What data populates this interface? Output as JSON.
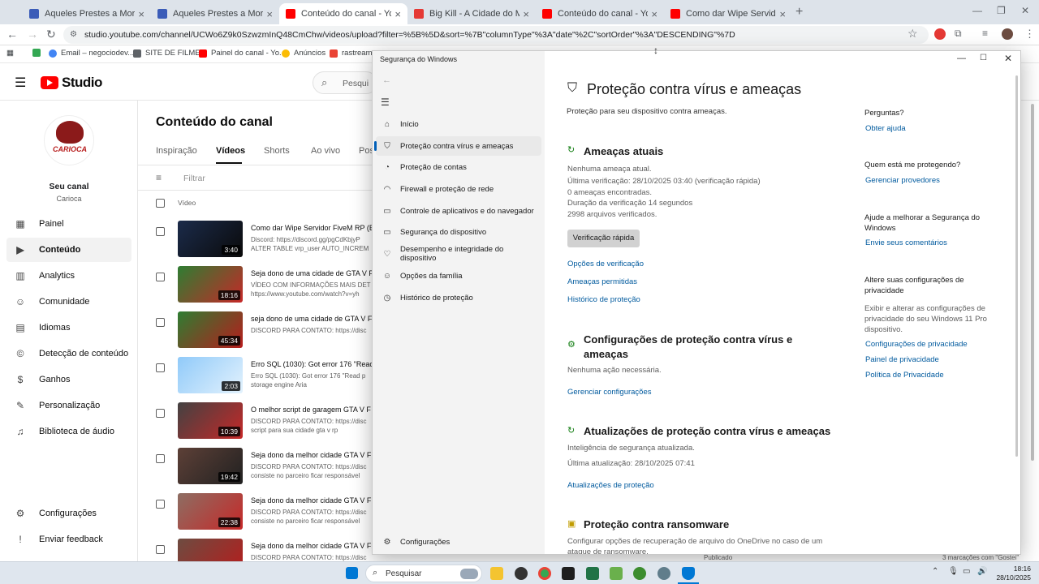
{
  "tabs": [
    {
      "label": "Aqueles Prestes a Morrer (Dub",
      "color": "#3b5cb8"
    },
    {
      "label": "Aqueles Prestes a Morrer - Epi",
      "color": "#3b5cb8"
    },
    {
      "label": "Conteúdo do canal - YouTube S",
      "color": "#ff0000"
    },
    {
      "label": "Big Kill - A Cidade do Medo | Fi",
      "color": "#e53935"
    },
    {
      "label": "Conteúdo do canal - YouTube S",
      "color": "#ff0000"
    },
    {
      "label": "Como dar Wipe Servidor FiveM",
      "color": "#ff0000"
    }
  ],
  "url": "studio.youtube.com/channel/UCWo6Z9k0SzwzmInQ48CmChw/videos/upload?filter=%5B%5D&sort=%7B\"columnType\"%3A\"date\"%2C\"sortOrder\"%3A\"DESCENDING\"%7D",
  "bookmarks": [
    "Email – negociodev...",
    "SITE DE FILMES",
    "Painel do canal - Yo...",
    "Anúncios",
    "rastreamen"
  ],
  "yt": {
    "logo": "Studio",
    "search_placeholder": "Pesqui",
    "page_title": "Conteúdo do canal",
    "tabs": [
      "Inspiração",
      "Vídeos",
      "Shorts",
      "Ao vivo",
      "Pos"
    ],
    "filter_placeholder": "Filtrar",
    "col_video": "Vídeo",
    "channel_avatar_text": "CARIOCA",
    "channel_label": "Seu canal",
    "channel_name": "Carioca",
    "side": [
      "Painel",
      "Conteúdo",
      "Analytics",
      "Comunidade",
      "Idiomas",
      "Detecção de conteúdo",
      "Ganhos",
      "Personalização",
      "Biblioteca de áudio"
    ],
    "side_bottom": [
      "Configurações",
      "Enviar feedback"
    ],
    "videos": [
      {
        "title": "Como dar Wipe Servidor FiveM RP (E",
        "desc1": "Discord: https://discord.gg/pgCdKbjyP",
        "desc2": "ALTER TABLE vrp_user AUTO_INCREM",
        "dur": "3:40",
        "c1": "#1b2b4a",
        "c2": "#0a0a0a"
      },
      {
        "title": "Seja dono de uma cidade de GTA V F",
        "desc1": "VÍDEO COM INFORMAÇÕES MAIS DET",
        "desc2": "https://www.youtube.com/watch?v=yh",
        "dur": "18:16",
        "c1": "#2e7d32",
        "c2": "#c62828"
      },
      {
        "title": "seja dono de uma cidade de GTA V Five",
        "desc1": "DISCORD PARA CONTATO: https://disc",
        "desc2": "",
        "dur": "45:34",
        "c1": "#2e7d32",
        "c2": "#b71c1c"
      },
      {
        "title": "Erro SQL (1030): Got error 176 \"Reac",
        "desc1": "Erro SQL (1030): Got error 176 \"Read p",
        "desc2": "storage engine Aria",
        "dur": "2:03",
        "c1": "#90caf9",
        "c2": "#e3f2fd"
      },
      {
        "title": "O melhor script de garagem GTA V F",
        "desc1": "DISCORD PARA CONTATO: https://disc",
        "desc2": "script para sua cidade gta v rp",
        "dur": "10:39",
        "c1": "#424242",
        "c2": "#c62828"
      },
      {
        "title": "Seja dono da melhor cidade GTA V F",
        "desc1": "DISCORD PARA CONTATO: https://disc",
        "desc2": "consiste no parceiro ficar responsável",
        "dur": "19:42",
        "c1": "#5d4037",
        "c2": "#212121"
      },
      {
        "title": "Seja dono da melhor cidade GTA V F",
        "desc1": "DISCORD PARA CONTATO: https://disc",
        "desc2": "consiste no parceiro ficar responsável",
        "dur": "22:38",
        "c1": "#8d6e63",
        "c2": "#c62828"
      },
      {
        "title": "Seja dono da melhor cidade GTA V Five",
        "desc1": "DISCORD PARA CONTATO: https://disc",
        "desc2": "",
        "dur": "",
        "c1": "#6d4c41",
        "c2": "#b71c1c"
      }
    ]
  },
  "security": {
    "window_title": "Segurança do Windows",
    "nav": [
      "Início",
      "Proteção contra vírus e ameaças",
      "Proteção de contas",
      "Firewall e proteção de rede",
      "Controle de aplicativos e do navegador",
      "Segurança do dispositivo",
      "Desempenho e integridade do dispositivo",
      "Opções da família",
      "Histórico de proteção"
    ],
    "nav_settings": "Configurações",
    "title": "Proteção contra vírus e ameaças",
    "subtitle": "Proteção para seu dispositivo contra ameaças.",
    "current_threats": {
      "heading": "Ameaças atuais",
      "lines": [
        "Nenhuma ameaça atual.",
        "Última verificação: 28/10/2025 03:40 (verificação rápida)",
        "0 ameaças encontradas.",
        "Duração da verificação 14 segundos",
        "2998 arquivos verificados."
      ],
      "button": "Verificação rápida",
      "links": [
        "Opções de verificação",
        "Ameaças permitidas",
        "Histórico de proteção"
      ]
    },
    "settings_section": {
      "heading": "Configurações de proteção contra vírus e ameaças",
      "line": "Nenhuma ação necessária.",
      "link": "Gerenciar configurações"
    },
    "updates": {
      "heading": "Atualizações de proteção contra vírus e ameaças",
      "lines": [
        "Inteligência de segurança atualizada.",
        "Última atualização: 28/10/2025 07:41"
      ],
      "link": "Atualizações de proteção"
    },
    "ransomware": {
      "heading": "Proteção contra ransomware",
      "line": "Configurar opções de recuperação de arquivo do OneDrive no caso de um ataque de ransomware."
    },
    "right": {
      "q_heading": "Perguntas?",
      "q_link": "Obter ajuda",
      "who_heading": "Quem está me protegendo?",
      "who_link": "Gerenciar provedores",
      "help_heading": "Ajude a melhorar a Segurança do Windows",
      "help_link": "Envie seus comentários",
      "priv_heading": "Altere suas configurações de privacidade",
      "priv_text": "Exibir e alterar as configurações de privacidade do seu Windows 11 Pro dispositivo.",
      "priv_links": [
        "Configurações de privacidade",
        "Painel de privacidade",
        "Política de Privacidade"
      ]
    }
  },
  "behind_text": {
    "published": "Publicado",
    "marks": "3 marcações com \"Gostei\""
  },
  "taskbar": {
    "search": "Pesquisar",
    "time": "18:16",
    "date": "28/10/2025"
  }
}
